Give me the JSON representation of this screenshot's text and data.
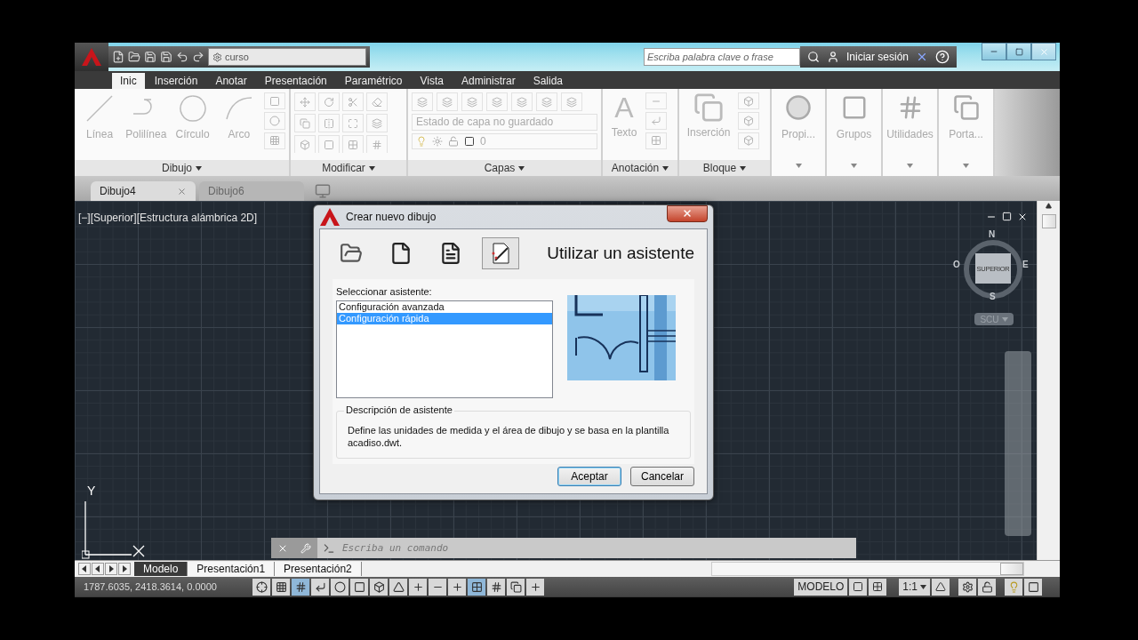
{
  "quick_access": {
    "workspace": "curso"
  },
  "search": {
    "placeholder": "Escriba palabra clave o frase"
  },
  "sign_in": "Iniciar sesión",
  "ribbon_tabs": [
    {
      "label": "Inic",
      "selected": true
    },
    {
      "label": "Inserción",
      "selected": false
    },
    {
      "label": "Anotar",
      "selected": false
    },
    {
      "label": "Presentación",
      "selected": false
    },
    {
      "label": "Paramétrico",
      "selected": false
    },
    {
      "label": "Vista",
      "selected": false
    },
    {
      "label": "Administrar",
      "selected": false
    },
    {
      "label": "Salida",
      "selected": false
    }
  ],
  "ribbon": {
    "draw_tools": [
      "Línea",
      "Polilínea",
      "Círculo",
      "Arco"
    ],
    "draw_title": "Dibujo",
    "modify_title": "Modificar",
    "layers_title": "Capas",
    "layer_state": "Estado de capa no guardado",
    "layer_name": "0",
    "annotation_glyph": "A",
    "annotation_tool": "Texto",
    "annotation_title": "Anotación",
    "block_tool": "Inserción",
    "block_title": "Bloque",
    "collapsed_panels": [
      "Propi...",
      "Grupos",
      "Utilidades",
      "Porta..."
    ]
  },
  "doc_tabs": [
    {
      "label": "Dibujo4",
      "selected": true
    },
    {
      "label": "Dibujo6",
      "selected": false
    }
  ],
  "viewport_label": "[−][Superior][Estructura alámbrica 2D]",
  "viewcube": {
    "face": "SUPERIOR",
    "north": "N",
    "south": "S",
    "east": "E",
    "west": "O",
    "ucs": "SCU"
  },
  "ucs_axes": {
    "y": "Y"
  },
  "dialog": {
    "title": "Crear nuevo dibujo",
    "modes": [
      {
        "kind": "open",
        "selected": false
      },
      {
        "kind": "start",
        "selected": false
      },
      {
        "kind": "template",
        "selected": false
      },
      {
        "kind": "wizard",
        "selected": true
      }
    ],
    "heading": "Utilizar un asistente",
    "list_label": "Seleccionar asistente:",
    "items": [
      {
        "label": "Configuración avanzada",
        "selected": false
      },
      {
        "label": "Configuración rápida",
        "selected": true
      }
    ],
    "description_title": "Descripción de asistente",
    "description": "Define las unidades de medida y el área de dibujo y se basa en la plantilla acadiso.dwt.",
    "buttons": [
      {
        "label": "Aceptar",
        "default": true
      },
      {
        "label": "Cancelar",
        "default": false
      }
    ]
  },
  "command_line": {
    "placeholder": "Escriba un comando"
  },
  "layout_tabs": [
    {
      "label": "Modelo",
      "selected": true
    },
    {
      "label": "Presentación1",
      "selected": false
    },
    {
      "label": "Presentación2",
      "selected": false
    }
  ],
  "status_bar": {
    "coordinates": "1787.6035, 2418.3614, 0.0000",
    "space": "MODELO",
    "scale": "1:1"
  }
}
